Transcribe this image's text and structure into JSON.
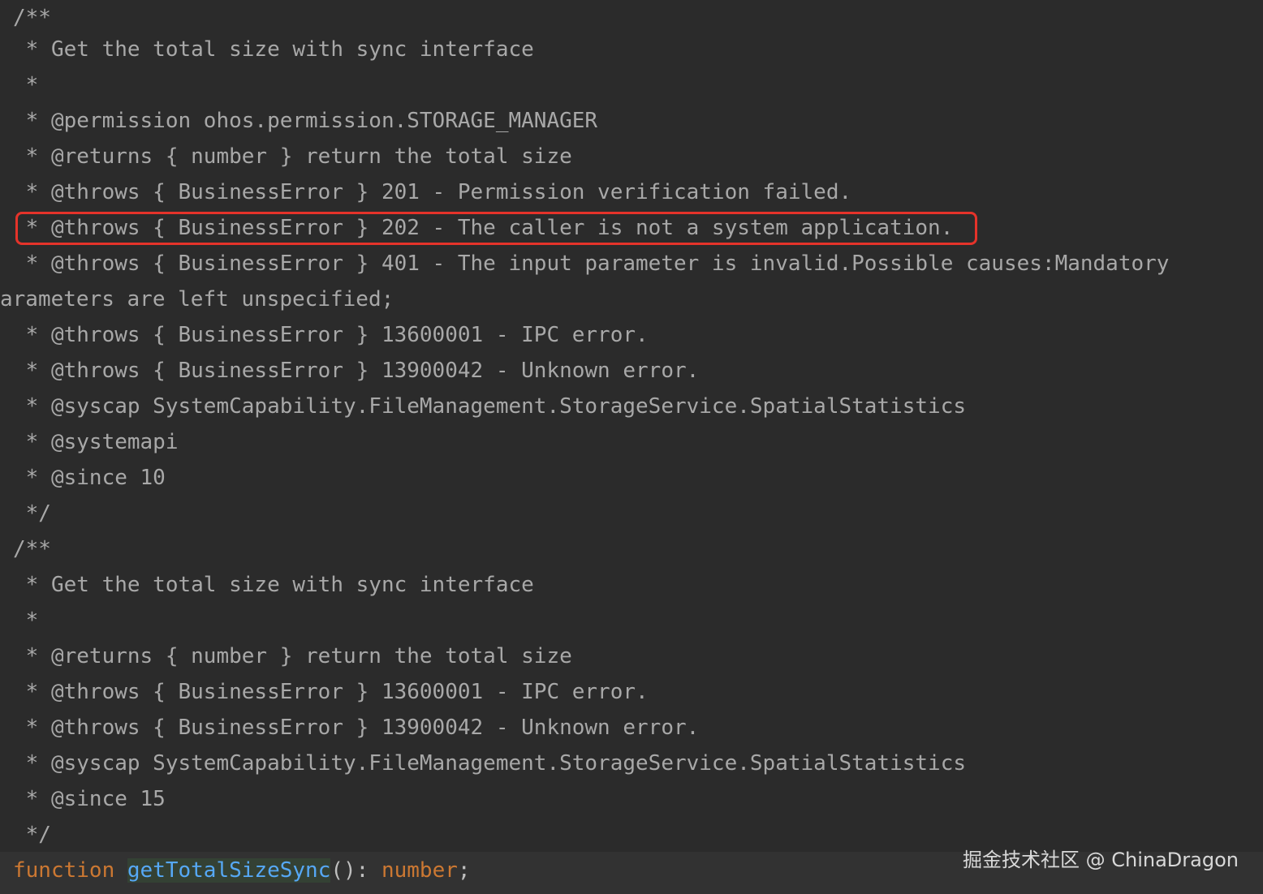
{
  "comment_blocks": [
    {
      "lines": [
        "/**",
        " * Get the total size with sync interface",
        " *",
        " * @permission ohos.permission.STORAGE_MANAGER",
        " * @returns { number } return the total size",
        " * @throws { BusinessError } 201 - Permission verification failed.",
        " * @throws { BusinessError } 202 - The caller is not a system application.",
        " * @throws { BusinessError } 401 - The input parameter is invalid.Possible causes:Mandatory",
        "arameters are left unspecified;",
        " * @throws { BusinessError } 13600001 - IPC error.",
        " * @throws { BusinessError } 13900042 - Unknown error.",
        " * @syscap SystemCapability.FileManagement.StorageService.SpatialStatistics",
        " * @systemapi",
        " * @since 10",
        " */"
      ]
    },
    {
      "lines": [
        "/**",
        " * Get the total size with sync interface",
        " *",
        " * @returns { number } return the total size",
        " * @throws { BusinessError } 13600001 - IPC error.",
        " * @throws { BusinessError } 13900042 - Unknown error.",
        " * @syscap SystemCapability.FileManagement.StorageService.SpatialStatistics",
        " * @since 15",
        " */"
      ]
    }
  ],
  "code_line": {
    "keyword": "function",
    "space": " ",
    "name": "getTotalSizeSync",
    "parens": "()",
    "colon": ": ",
    "return_type": "number",
    "semicolon": ";"
  },
  "highlight": {
    "color": "#e5332a",
    "target_line": " * @throws { BusinessError } 202 - The caller is not a system application."
  },
  "watermark": "掘金技术社区 @ ChinaDragon",
  "colors": {
    "background": "#2b2b2b",
    "comment": "#a8a8a8",
    "keyword": "#cc7832",
    "function_name": "#56a8f5"
  }
}
